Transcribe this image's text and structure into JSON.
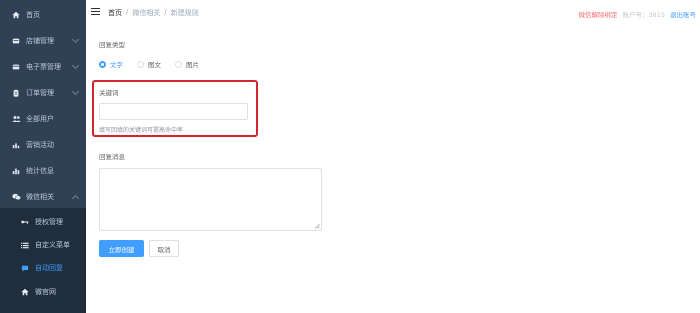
{
  "sidebar": {
    "items": [
      {
        "icon": "home-icon",
        "label": "首页",
        "expandable": false
      },
      {
        "icon": "store-icon",
        "label": "店铺管理",
        "expandable": true
      },
      {
        "icon": "ticket-icon",
        "label": "电子票管理",
        "expandable": true
      },
      {
        "icon": "clipboard-icon",
        "label": "订单管理",
        "expandable": true
      },
      {
        "icon": "users-icon",
        "label": "全部用户",
        "expandable": false
      },
      {
        "icon": "chart-icon",
        "label": "营销活动",
        "expandable": false
      },
      {
        "icon": "stats-icon",
        "label": "统计信息",
        "expandable": false
      },
      {
        "icon": "wechat-icon",
        "label": "微信相关",
        "expandable": true
      }
    ],
    "sub_items": [
      {
        "icon": "link-icon",
        "label": "授权管理"
      },
      {
        "icon": "list-icon",
        "label": "自定义菜单"
      },
      {
        "icon": "message-icon",
        "label": "自动回复",
        "active": true
      },
      {
        "icon": "home-icon",
        "label": "微官网"
      }
    ]
  },
  "header": {
    "breadcrumb": [
      "首页",
      "/",
      "微信相关",
      "/",
      "新建规则"
    ],
    "unbind": "微信解除绑定",
    "account": "账户号：3815",
    "logout": "退出账号"
  },
  "form": {
    "reply_type_label": "回复类型",
    "reply_types": [
      {
        "label": "文字",
        "checked": true
      },
      {
        "label": "图文",
        "checked": false
      },
      {
        "label": "图片",
        "checked": false
      }
    ],
    "keyword_label": "关键词",
    "keyword_value": "",
    "keyword_hint": "填写回填的关键词可提高命中率",
    "message_label": "回复消息",
    "message_value": "",
    "submit_label": "立即创建",
    "cancel_label": "取消"
  },
  "colors": {
    "sidebar_bg": "#304156",
    "submenu_bg": "#1f2d3d",
    "primary": "#409eff",
    "danger": "#f56c6c",
    "highlight_border": "#d0262d"
  }
}
